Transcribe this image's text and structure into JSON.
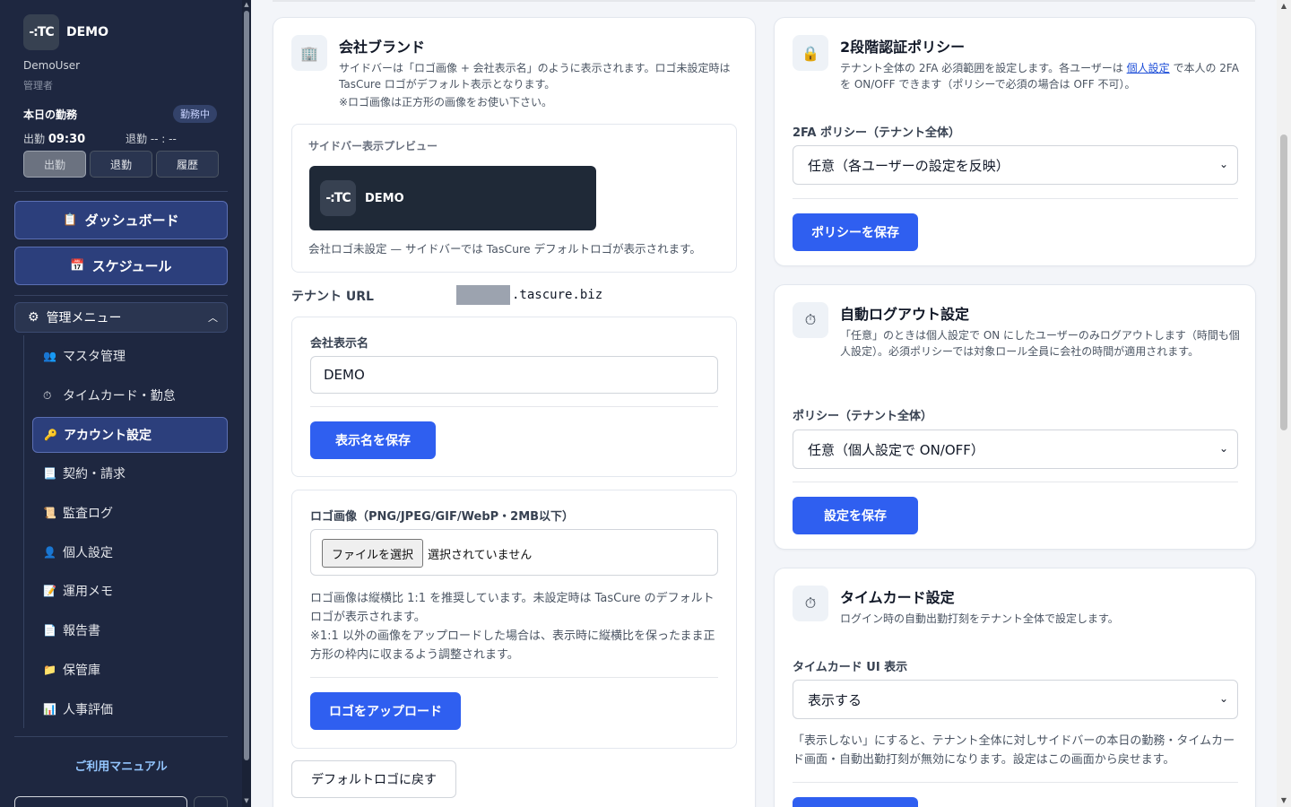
{
  "sidebar": {
    "logo_text": "-:TC",
    "company": "DEMO",
    "user_name": "DemoUser",
    "user_role": "管理者",
    "attendance": {
      "title": "本日の勤務",
      "badge": "勤務中",
      "clock_in_label": "出勤",
      "clock_in_time": "09:30",
      "clock_out": "退勤 -- : --",
      "buttons": [
        "出勤",
        "退勤",
        "履歴"
      ]
    },
    "dashboard": "ダッシュボード",
    "schedule": "スケジュール",
    "admin_menu": "管理メニュー",
    "admin_items": [
      {
        "icon": "👥",
        "label": "マスタ管理"
      },
      {
        "icon": "⏱",
        "label": "タイムカード・勤怠"
      },
      {
        "icon": "🔑",
        "label": "アカウント設定"
      },
      {
        "icon": "📃",
        "label": "契約・請求"
      },
      {
        "icon": "📜",
        "label": "監査ログ"
      },
      {
        "icon": "👤",
        "label": "個人設定"
      },
      {
        "icon": "📝",
        "label": "運用メモ"
      },
      {
        "icon": "📄",
        "label": "報告書"
      },
      {
        "icon": "📁",
        "label": "保管庫"
      },
      {
        "icon": "📊",
        "label": "人事評価"
      }
    ],
    "manual": "ご利用マニュアル"
  },
  "brand_card": {
    "title": "会社ブランド",
    "desc1": "サイドバーは「ロゴ画像 + 会社表示名」のように表示されます。ロゴ未設定時は TasCure ロゴがデフォルト表示となります。",
    "desc2": "※ロゴ画像は正方形の画像をお使い下さい。",
    "preview_label": "サイドバー表示プレビュー",
    "preview_logo": "-:TC",
    "preview_name": "DEMO",
    "preview_note": "会社ロゴ未設定 — サイドバーでは TasCure デフォルトロゴが表示されます。",
    "tenant_url_label": "テナント URL",
    "tenant_url_suffix": ".tascure.biz",
    "display_name_label": "会社表示名",
    "display_name_value": "DEMO",
    "save_name_button": "表示名を保存",
    "logo_label": "ロゴ画像（PNG/JPEG/GIF/WebP・2MB以下）",
    "file_button": "ファイルを選択",
    "file_none": "選択されていません",
    "logo_note1": "ロゴ画像は縦横比 1:1 を推奨しています。未設定時は TasCure のデフォルトロゴが表示されます。",
    "logo_note2": "※1:1 以外の画像をアップロードした場合は、表示時に縦横比を保ったまま正方形の枠内に収まるよう調整されます。",
    "upload_button": "ロゴをアップロード",
    "reset_button": "デフォルトロゴに戻す"
  },
  "twofa_card": {
    "title": "2段階認証ポリシー",
    "desc_pre": "テナント全体の 2FA 必須範囲を設定します。各ユーザーは ",
    "desc_link": "個人設定",
    "desc_post": " で本人の 2FA を ON/OFF できます（ポリシーで必須の場合は OFF 不可）。",
    "field_label": "2FA ポリシー（テナント全体）",
    "select_value": "任意（各ユーザーの設定を反映）",
    "save_button": "ポリシーを保存"
  },
  "logout_card": {
    "title": "自動ログアウト設定",
    "desc": "「任意」のときは個人設定で ON にしたユーザーのみログアウトします（時間も個人設定）。必須ポリシーでは対象ロール全員に会社の時間が適用されます。",
    "field_label": "ポリシー（テナント全体）",
    "select_value": "任意（個人設定で ON/OFF）",
    "save_button": "設定を保存"
  },
  "timecard_card": {
    "title": "タイムカード設定",
    "desc": "ログイン時の自動出勤打刻をテナント全体で設定します。",
    "field_label": "タイムカード UI 表示",
    "select_value": "表示する",
    "note": "「表示しない」にすると、テナント全体に対しサイドバーの本日の勤務・タイムカード画面・自動出勤打刻が無効になります。設定はこの画面から戻せます。"
  }
}
